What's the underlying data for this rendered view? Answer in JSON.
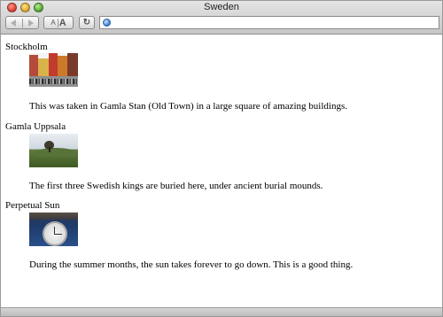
{
  "window": {
    "title": "Sweden"
  },
  "toolbar": {
    "back_icon": "back-arrow-icon",
    "forward_icon": "forward-arrow-icon",
    "smaller_text_label": "A",
    "bigger_text_label": "A",
    "reload_icon": "reload-icon",
    "address_value": "",
    "site_icon": "globe-icon"
  },
  "entries": [
    {
      "title": "Stockholm",
      "caption": "This was taken in Gamla Stan (Old Town) in a large square of amazing buildings."
    },
    {
      "title": "Gamla Uppsala",
      "caption": "The first three Swedish kings are buried here, under ancient burial mounds."
    },
    {
      "title": "Perpetual Sun",
      "caption": "During the summer months, the sun takes forever to go down. This is a good thing."
    }
  ]
}
